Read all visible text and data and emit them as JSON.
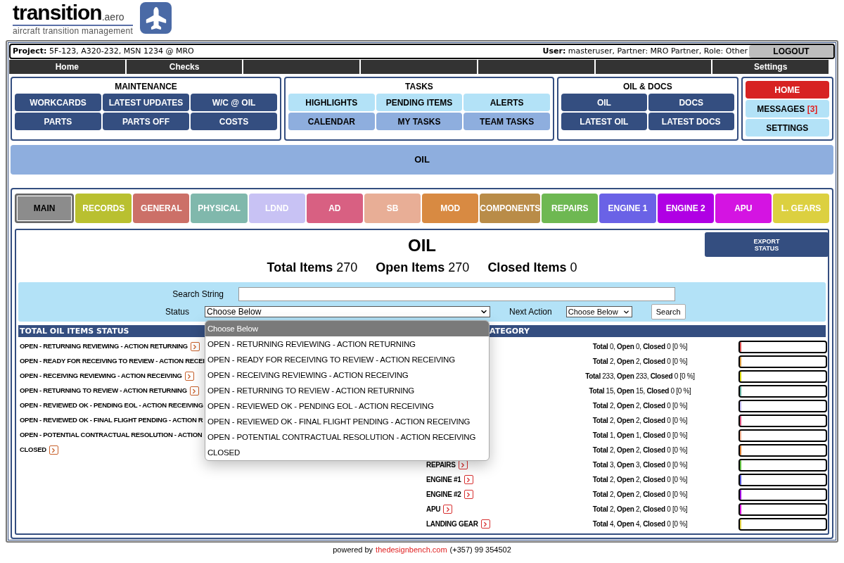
{
  "logo": {
    "name": "transition",
    "suffix": ".aero",
    "tagline": "aircraft transition management"
  },
  "project": {
    "label": "Project:",
    "value": "5F-123, A320-232, MSN 1234 @ MRO"
  },
  "user": {
    "label": "User:",
    "value": "masteruser, Partner: MRO Partner, Role: Other"
  },
  "logout": "LOGOUT",
  "nav": [
    {
      "kind": "link",
      "label": "Home"
    },
    {
      "kind": "link",
      "label": "Checks"
    },
    {
      "kind": "blank"
    },
    {
      "kind": "blank"
    },
    {
      "kind": "blank"
    },
    {
      "kind": "blank"
    },
    {
      "kind": "link",
      "label": "Settings"
    }
  ],
  "menu_groups": [
    {
      "title": "MAINTENANCE",
      "buttons": [
        {
          "label": "WORKCARDS",
          "kind": "dark"
        },
        {
          "label": "LATEST UPDATES",
          "kind": "dark"
        },
        {
          "label": "W/C @ OIL",
          "kind": "dark"
        },
        {
          "label": "PARTS",
          "kind": "dark"
        },
        {
          "label": "PARTS OFF",
          "kind": "dark"
        },
        {
          "label": "COSTS",
          "kind": "dark"
        }
      ]
    },
    {
      "title": "TASKS",
      "buttons": [
        {
          "label": "HIGHLIGHTS",
          "kind": "light"
        },
        {
          "label": "PENDING ITEMS",
          "kind": "light"
        },
        {
          "label": "ALERTS",
          "kind": "light"
        },
        {
          "label": "CALENDAR",
          "kind": "medium"
        },
        {
          "label": "MY TASKS",
          "kind": "medium"
        },
        {
          "label": "TEAM TASKS",
          "kind": "medium"
        }
      ]
    },
    {
      "title": "OIL & DOCS",
      "buttons": [
        {
          "label": "OIL",
          "kind": "dark"
        },
        {
          "label": "DOCS",
          "kind": "dark"
        },
        {
          "label": "LATEST OIL",
          "kind": "dark"
        },
        {
          "label": "LATEST DOCS",
          "kind": "dark"
        }
      ]
    },
    {
      "buttons": [
        {
          "label": "HOME",
          "kind": "red"
        },
        {
          "label": "MESSAGES",
          "badge": "[3]",
          "kind": "light"
        },
        {
          "label": "SETTINGS",
          "kind": "light"
        }
      ]
    }
  ],
  "banner": "OIL",
  "tabs": [
    {
      "label": "MAIN",
      "color": "#8c8c8c",
      "selected": true
    },
    {
      "label": "RECORDS",
      "color": "#b9c030",
      "selected": false
    },
    {
      "label": "GENERAL",
      "color": "#cc7068",
      "selected": false
    },
    {
      "label": "PHYSICAL",
      "color": "#80b8ac",
      "selected": false
    },
    {
      "label": "LDND",
      "color": "#c8c2f4",
      "selected": false
    },
    {
      "label": "AD",
      "color": "#d86082",
      "selected": false
    },
    {
      "label": "SB",
      "color": "#e8ae96",
      "selected": false
    },
    {
      "label": "MOD",
      "color": "#d88a42",
      "selected": false
    },
    {
      "label": "COMPONENTS",
      "color": "#b98c48",
      "selected": false
    },
    {
      "label": "REPAIRS",
      "color": "#6eb852",
      "selected": false
    },
    {
      "label": "ENGINE 1",
      "color": "#6a62e6",
      "selected": false
    },
    {
      "label": "ENGINE 2",
      "color": "#b000e4",
      "selected": false
    },
    {
      "label": "APU",
      "color": "#d414e2",
      "selected": false
    },
    {
      "label": "L. GEARS",
      "color": "#dcd040",
      "selected": false
    }
  ],
  "panel": {
    "title": "OIL",
    "export_button": "EXPORT STATUS",
    "totals": [
      {
        "label": "Total Items",
        "value": "270"
      },
      {
        "label": "Open Items",
        "value": "270"
      },
      {
        "label": "Closed Items",
        "value": "0"
      }
    ]
  },
  "search": {
    "search_label": "Search String",
    "status_label": "Status",
    "status_value": "Choose Below",
    "next_action_label": "Next Action",
    "next_action_value": "Choose Below",
    "search_button": "Search"
  },
  "status_dropdown": [
    {
      "label": "Choose Below",
      "selected": true
    },
    {
      "label": "OPEN - RETURNING REVIEWING - ACTION RETURNING",
      "selected": false
    },
    {
      "label": "OPEN - READY FOR RECEIVING TO REVIEW - ACTION RECEIVING",
      "selected": false
    },
    {
      "label": "OPEN - RECEIVING REVIEWING - ACTION RECEIVING",
      "selected": false
    },
    {
      "label": "OPEN - RETURNING TO REVIEW - ACTION RETURNING",
      "selected": false
    },
    {
      "label": "OPEN - REVIEWED OK - PENDING EOL - ACTION RECEIVING",
      "selected": false
    },
    {
      "label": "OPEN - REVIEWED OK - FINAL FLIGHT PENDING - ACTION RECEIVING",
      "selected": false
    },
    {
      "label": "OPEN - POTENTIAL CONTRACTUAL RESOLUTION - ACTION RECEIVING",
      "selected": false
    },
    {
      "label": "CLOSED",
      "selected": false
    }
  ],
  "status_table": {
    "header": "TOTAL OIL ITEMS STATUS",
    "rows": [
      {
        "label": "OPEN - RETURNING REVIEWING - ACTION RETURNING",
        "arrow": true
      },
      {
        "label": "OPEN - READY FOR RECEIVING TO REVIEW - ACTION RECEI"
      },
      {
        "label": "OPEN - RECEIVING REVIEWING - ACTION RECEIVING",
        "arrow": true
      },
      {
        "label": "OPEN - RETURNING TO REVIEW - ACTION RETURNING",
        "arrow": true
      },
      {
        "label": "OPEN - REVIEWED OK - PENDING EOL - ACTION RECEIVING"
      },
      {
        "label": "OPEN - REVIEWED OK - FINAL FLIGHT PENDING - ACTION R"
      },
      {
        "label": "OPEN - POTENTIAL CONTRACTUAL RESOLUTION - ACTION"
      },
      {
        "label": "CLOSED",
        "arrow": true
      }
    ]
  },
  "category_table": {
    "header": "ATEGORY",
    "rows": [
      {
        "stats": "**Total** 0, **Open** 0, **Closed** 0 [0 %]",
        "level": 0,
        "color": "#e05050"
      },
      {
        "stats": "**Total** 2, **Open** 2, **Closed** 0 [0 %]",
        "level": 0,
        "color": "#e0a040"
      },
      {
        "stats": "**Total** 233, **Open** 233, **Closed** 0 [0 %]",
        "level": 0,
        "color": "#d8d800"
      },
      {
        "stats": "**Total** 15, **Open** 15, **Closed** 0 [0 %]",
        "level": 0,
        "color": "#60b0a0"
      },
      {
        "stats": "**Total** 2, **Open** 2, **Closed** 0 [0 %]",
        "level": 0,
        "color": "#c0b8f0"
      },
      {
        "stats": "**Total** 2, **Open** 2, **Closed** 0 [0 %]",
        "level": 0,
        "color": "#e05080"
      },
      {
        "stats": "**Total** 1, **Open** 1, **Closed** 0 [0 %]",
        "level": 0,
        "color": "#f0b090"
      },
      {
        "stats": "**Total** 2, **Open** 2, **Closed** 0 [0 %]",
        "level": 0,
        "color": "#e08030"
      },
      {
        "name": "REPAIRS",
        "stats": "**Total** 3, **Open** 3, **Closed** 0 [0 %]",
        "level": 0,
        "color": "#60c040"
      },
      {
        "name": "ENGINE #1",
        "stats": "**Total** 2, **Open** 2, **Closed** 0 [0 %]",
        "level": 0,
        "color": "#5050e0"
      },
      {
        "name": "ENGINE #2",
        "stats": "**Total** 2, **Open** 2, **Closed** 0 [0 %]",
        "level": 0,
        "color": "#a000e0"
      },
      {
        "name": "APU",
        "stats": "**Total** 2, **Open** 2, **Closed** 0 [0 %]",
        "level": 0,
        "color": "#e000e0"
      },
      {
        "name": "LANDING GEAR",
        "stats": "**Total** 4, **Open** 4, **Closed** 0 [0 %]",
        "level": 0,
        "color": "#e0d040"
      }
    ]
  },
  "footer": {
    "prefix": "powered by",
    "link": "thedesignbench.com",
    "phone": "(+357) 99 354502"
  }
}
